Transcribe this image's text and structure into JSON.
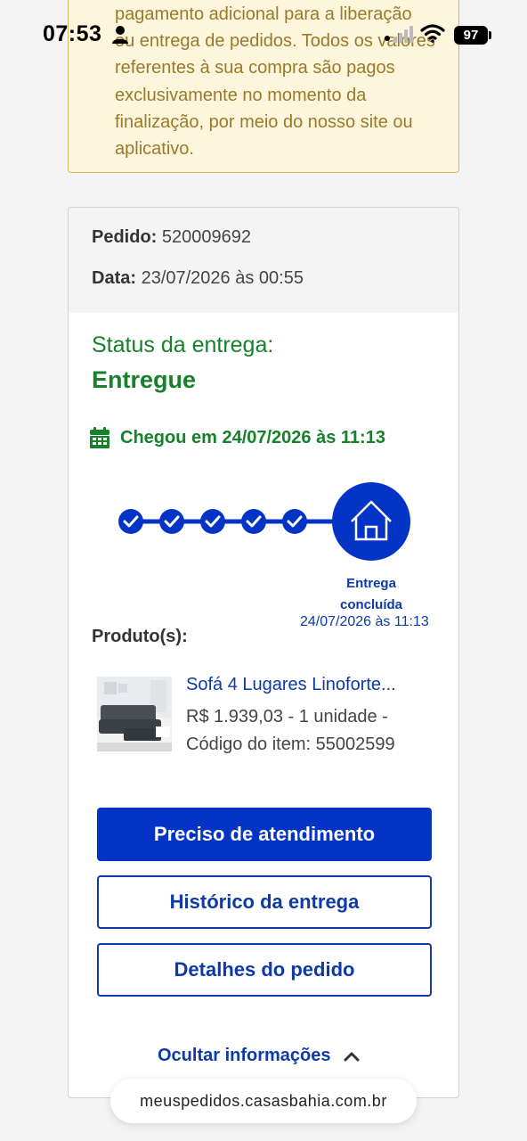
{
  "status_bar": {
    "time": "07:53",
    "battery": "97"
  },
  "notice": {
    "text": "pagamento adicional para a liberação ou entrega de pedidos. Todos os valores referentes à sua compra são pagos exclusivamente no momento da finalização, por meio do nosso site ou aplicativo."
  },
  "order": {
    "number_label": "Pedido:",
    "number": "520009692",
    "date_label": "Data:",
    "date": "23/07/2026 às 00:55"
  },
  "delivery": {
    "status_label": "Status da entrega:",
    "status_value": "Entregue",
    "arrived_text": "Chegou em 24/07/2026 às 11:13",
    "completed_steps": 5,
    "final_step_label": "Entrega concluída",
    "final_step_date": "24/07/2026 às 11:13"
  },
  "products": {
    "label": "Produto(s):",
    "items": [
      {
        "name": "Sofá 4 Lugares Linoforte...",
        "price_line": "R$ 1.939,03 - 1 unidade -",
        "code_line": "Código do item: 55002599"
      }
    ]
  },
  "buttons": {
    "support": "Preciso de atendimento",
    "history": "Histórico da entrega",
    "details": "Detalhes do pedido",
    "hide_info": "Ocultar informações"
  },
  "browser": {
    "url": "meuspedidos.casasbahia.com.br"
  },
  "colors": {
    "brand_blue": "#0434c6",
    "link_blue": "#0e3aa8",
    "success_green": "#17802b",
    "notice_bg": "#fdf6dd",
    "notice_text": "#9a7a2a"
  }
}
